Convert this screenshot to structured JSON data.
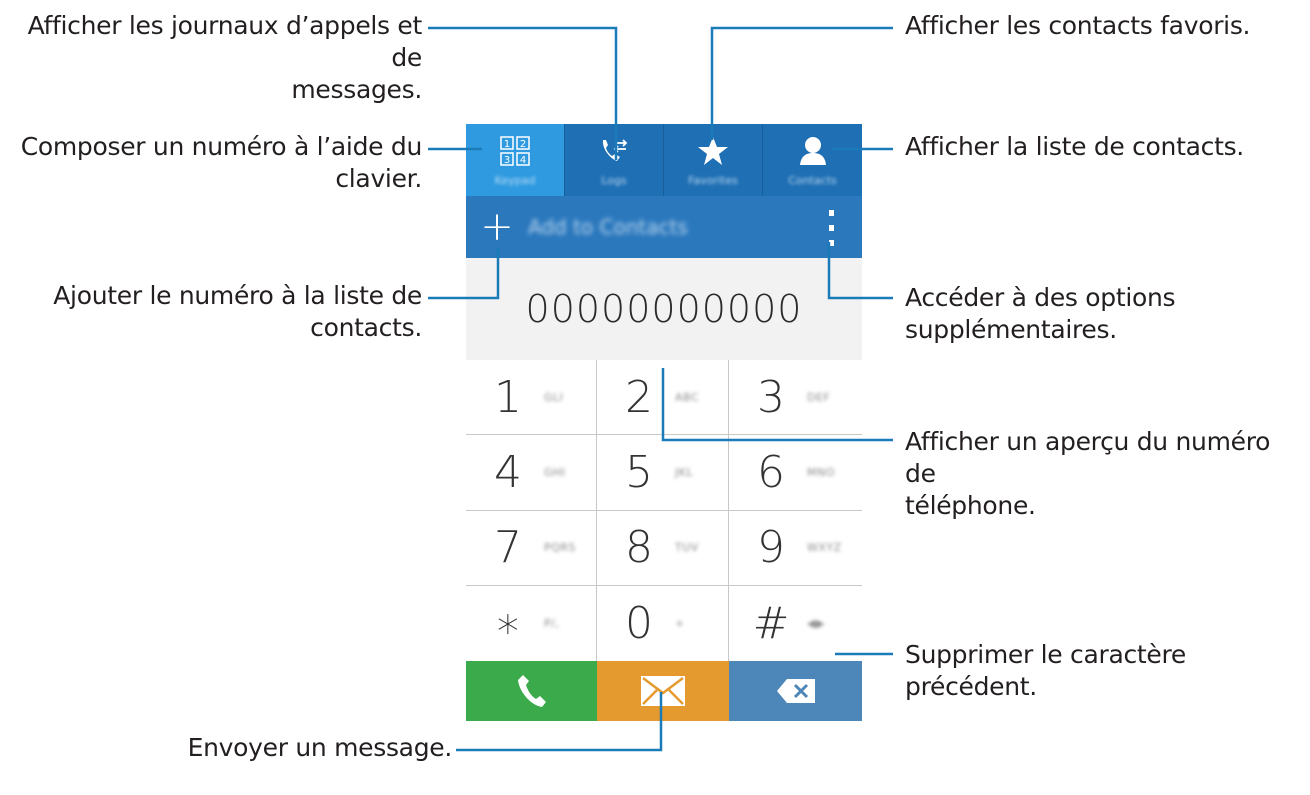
{
  "callouts": {
    "logs": "Afficher les journaux d’appels et de messages.",
    "logs_line1": "Afficher les journaux d’appels et de",
    "logs_line2": "messages.",
    "keypad_line1": "Composer un numéro à l’aide du",
    "keypad_line2": "clavier.",
    "add_line1": "Ajouter le numéro à la liste de",
    "add_line2": "contacts.",
    "message": "Envoyer un message.",
    "favorites": "Afficher les contacts favoris.",
    "contacts": "Afficher la liste de contacts.",
    "options_line1": "Accéder à des options",
    "options_line2": "supplémentaires.",
    "preview_line1": "Afficher un aperçu du numéro de",
    "preview_line2": "téléphone.",
    "delete": "Supprimer le caractère précédent."
  },
  "phone": {
    "tabs": [
      {
        "label": "Keypad",
        "icon": "keypad-icon",
        "active": true
      },
      {
        "label": "Logs",
        "icon": "logs-icon",
        "active": false
      },
      {
        "label": "Favorites",
        "icon": "star-icon",
        "active": false
      },
      {
        "label": "Contacts",
        "icon": "person-icon",
        "active": false
      }
    ],
    "add_to_contacts_label": "Add to Contacts",
    "add_icon_glyph": "+",
    "number_display": "00000000000",
    "keys": [
      {
        "digit": "1",
        "letters": "GLI"
      },
      {
        "digit": "2",
        "letters": "ABC"
      },
      {
        "digit": "3",
        "letters": "DEF"
      },
      {
        "digit": "4",
        "letters": "GHI"
      },
      {
        "digit": "5",
        "letters": "JKL"
      },
      {
        "digit": "6",
        "letters": "MNO"
      },
      {
        "digit": "7",
        "letters": "PQRS"
      },
      {
        "digit": "8",
        "letters": "TUV"
      },
      {
        "digit": "9",
        "letters": "WXYZ"
      },
      {
        "digit": "∗",
        "letters": "P/,"
      },
      {
        "digit": "0",
        "letters": "+"
      },
      {
        "digit": "#",
        "letters": "◀▶"
      }
    ],
    "colors": {
      "tab_active": "#2f9ae0",
      "tab_inactive": "#1f6fb4",
      "add_bar": "#2b78bd",
      "call": "#3aaa4b",
      "message": "#e59a2f",
      "delete": "#4d86b8",
      "leader": "#1a7bb8"
    }
  }
}
